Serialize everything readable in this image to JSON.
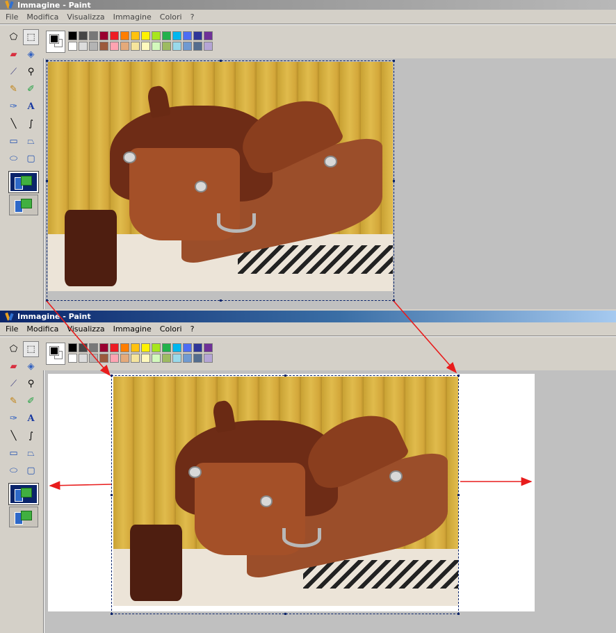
{
  "windows": [
    {
      "title": "Immagine - Paint",
      "active": false,
      "menu": [
        "File",
        "Modifica",
        "Visualizza",
        "Immagine",
        "Colori",
        "?"
      ]
    },
    {
      "title": "Immagine - Paint",
      "active": true,
      "menu": [
        "File",
        "Modifica",
        "Visualizza",
        "Immagine",
        "Colori",
        "?"
      ]
    }
  ],
  "tools": [
    "free-form-select-icon",
    "select-icon",
    "eraser-icon",
    "fill-icon",
    "pick-color-icon",
    "magnifier-icon",
    "pencil-icon",
    "brush-icon",
    "airbrush-icon",
    "text-icon",
    "line-icon",
    "curve-icon",
    "rectangle-icon",
    "polygon-icon",
    "ellipse-icon",
    "rounded-rectangle-icon"
  ],
  "tool_options": [
    "opaque-selection-option",
    "transparent-selection-option"
  ],
  "palette": {
    "foreground": "#000000",
    "background": "#ffffff",
    "row1": [
      "#000000",
      "#464646",
      "#787878",
      "#990030",
      "#ed1c24",
      "#ff7e00",
      "#ffc20e",
      "#fff200",
      "#a8e61d",
      "#22b14c",
      "#00b7ef",
      "#4d6df3",
      "#2f3699",
      "#6f3198"
    ],
    "row2": [
      "#ffffff",
      "#dcdcdc",
      "#b4b4b4",
      "#9c5a3c",
      "#ffa3b1",
      "#e5aa7a",
      "#f5e49c",
      "#fff9bd",
      "#d3f9bc",
      "#9dbb61",
      "#99d9ea",
      "#709ad1",
      "#546d8e",
      "#b5a5d5"
    ]
  },
  "arrow_color": "#e81c1c"
}
